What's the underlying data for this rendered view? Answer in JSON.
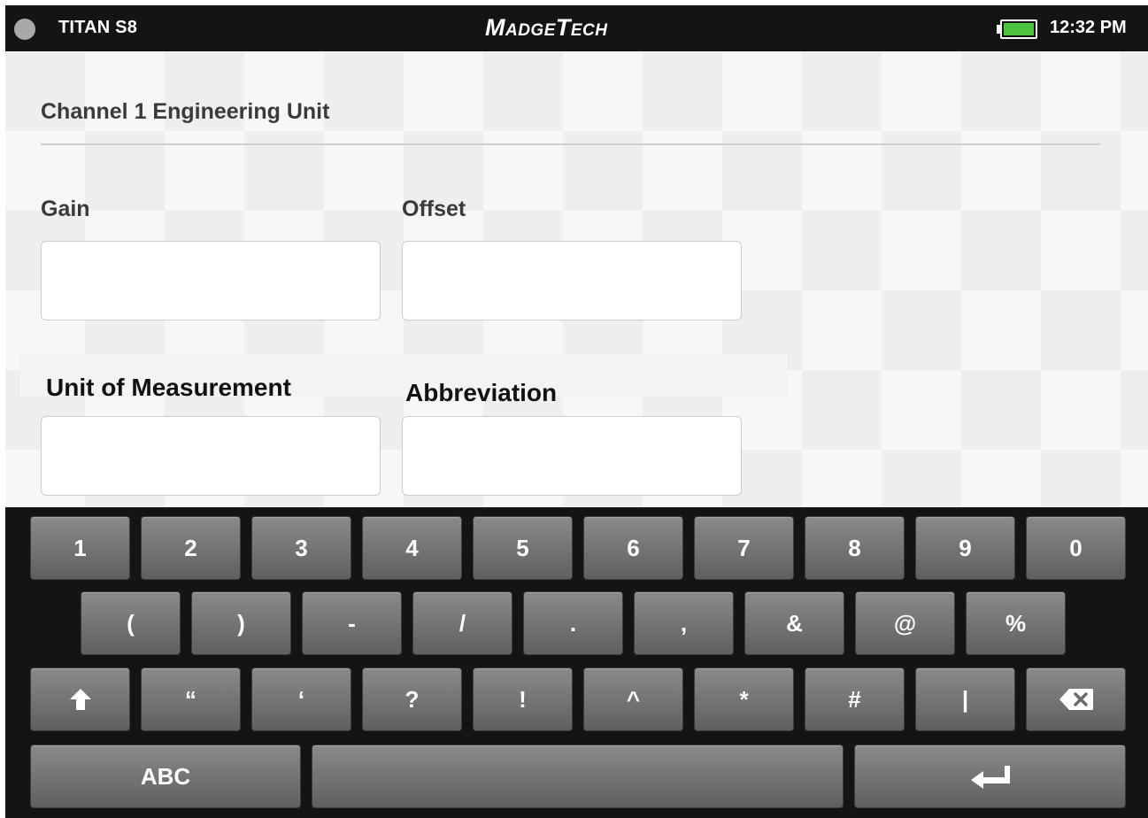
{
  "status_bar": {
    "device_name": "TITAN S8",
    "brand": "MadgeTech",
    "time": "12:32 PM",
    "battery_color": "#4dc23e"
  },
  "page": {
    "title": "Channel 1 Engineering Unit"
  },
  "fields": {
    "gain": {
      "label": "Gain",
      "value": ""
    },
    "offset": {
      "label": "Offset",
      "value": ""
    },
    "unit": {
      "label": "Unit of Measurement",
      "value": ""
    },
    "abbreviation": {
      "label": "Abbreviation",
      "value": ""
    }
  },
  "keyboard": {
    "row1": [
      "1",
      "2",
      "3",
      "4",
      "5",
      "6",
      "7",
      "8",
      "9",
      "0"
    ],
    "row2": [
      "(",
      ")",
      "-",
      "/",
      ".",
      ",",
      "&",
      "@",
      "%"
    ],
    "row3": [
      "“",
      "‘",
      "?",
      "!",
      "^",
      "*",
      "#",
      "|"
    ],
    "abc_label": "ABC",
    "icons": {
      "shift": "shift-arrow-icon",
      "backspace": "backspace-icon",
      "enter": "enter-return-icon"
    }
  }
}
